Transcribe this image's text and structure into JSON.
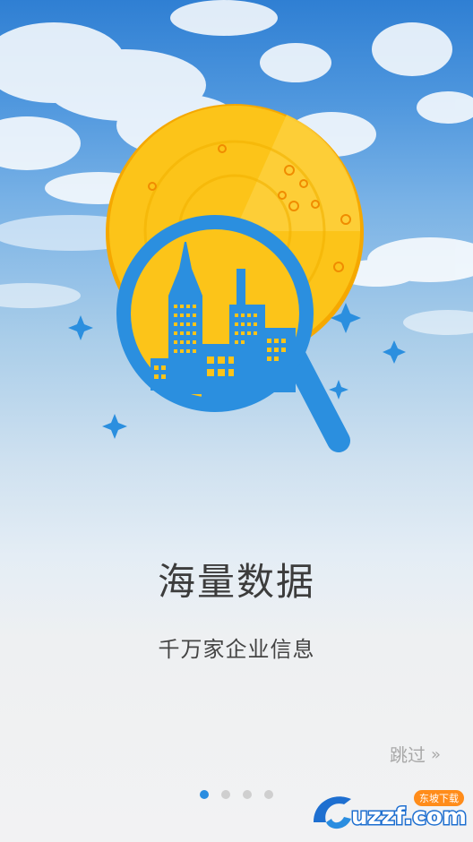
{
  "onboarding": {
    "title": "海量数据",
    "subtitle": "千万家企业信息",
    "skip_label": "跳过",
    "skip_chevron": "»",
    "page_count": 4,
    "current_page": 1
  },
  "illustration": {
    "icon": "magnifier-city-icon",
    "coin_color": "#fcc419",
    "magnifier_color": "#2b8fdf"
  },
  "watermark": {
    "brand": "uzzf.com",
    "tag": "东坡下载"
  },
  "colors": {
    "accent": "#2a8de0",
    "dot_inactive": "#cfcfcf",
    "title_text": "#3c3c3c",
    "skip_text": "#a8a8a8"
  }
}
